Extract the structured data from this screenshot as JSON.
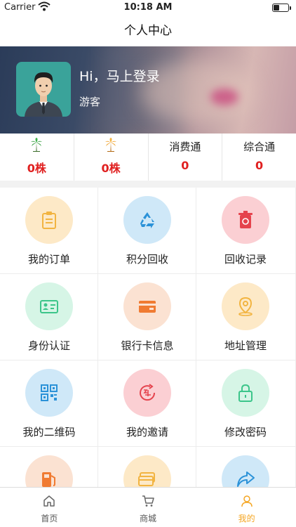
{
  "status_bar": {
    "carrier": "Carrier",
    "time": "10:18 AM"
  },
  "nav": {
    "title": "个人中心"
  },
  "profile": {
    "greeting": "Hi，马上登录",
    "role": "游客"
  },
  "stats": [
    {
      "label": "",
      "icon": "green-palm-tree-icon",
      "value": "0株"
    },
    {
      "label": "",
      "icon": "orange-palm-tree-icon",
      "value": "0株"
    },
    {
      "label": "消费通",
      "value": "0"
    },
    {
      "label": "综合通",
      "value": "0"
    }
  ],
  "grid": [
    {
      "label": "我的订单",
      "icon": "clipboard-icon",
      "bg": "#fde9c7",
      "fg": "#f2b441"
    },
    {
      "label": "积分回收",
      "icon": "recycle-icon",
      "bg": "#cfe8f8",
      "fg": "#2b92d8"
    },
    {
      "label": "回收记录",
      "icon": "trash-bin-icon",
      "bg": "#fbcfd3",
      "fg": "#e5434d"
    },
    {
      "label": "身份认证",
      "icon": "id-card-icon",
      "bg": "#d6f5e6",
      "fg": "#3cc58a"
    },
    {
      "label": "银行卡信息",
      "icon": "bank-card-icon",
      "bg": "#fbe2d2",
      "fg": "#f07b32"
    },
    {
      "label": "地址管理",
      "icon": "location-pin-icon",
      "bg": "#fde9c7",
      "fg": "#f2b441"
    },
    {
      "label": "我的二维码",
      "icon": "qr-code-icon",
      "bg": "#cfe8f8",
      "fg": "#2b92d8"
    },
    {
      "label": "我的邀请",
      "icon": "invite-icon",
      "bg": "#fbcfd3",
      "fg": "#e5434d"
    },
    {
      "label": "修改密码",
      "icon": "lock-icon",
      "bg": "#d6f5e6",
      "fg": "#3cc58a"
    },
    {
      "label": "",
      "icon": "fuel-pump-icon",
      "bg": "#fbe2d2",
      "fg": "#f07b32"
    },
    {
      "label": "",
      "icon": "cards-icon",
      "bg": "#fde9c7",
      "fg": "#f2b441"
    },
    {
      "label": "",
      "icon": "share-arrow-icon",
      "bg": "#cfe8f8",
      "fg": "#2b92d8"
    }
  ],
  "tabs": [
    {
      "label": "首页",
      "icon": "home-icon"
    },
    {
      "label": "商城",
      "icon": "shopping-cart-icon"
    },
    {
      "label": "我的",
      "icon": "person-icon",
      "active": true
    }
  ],
  "colors": {
    "accent": "#f5a623",
    "stat_value": "#e02020"
  }
}
